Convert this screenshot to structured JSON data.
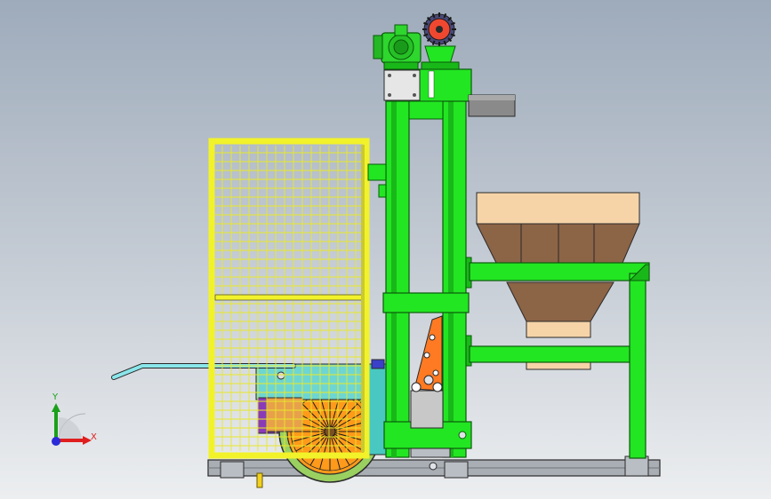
{
  "triad": {
    "y_label": "Y",
    "x_label": "X",
    "colors": {
      "y": "#1aa01a",
      "x": "#e01e1e",
      "z": "#2a2ad8"
    }
  },
  "colors": {
    "frame_green": "#22e622",
    "frame_outline": "#0a5a0a",
    "guard_yellow": "#f2f22a",
    "hopper_tan": "#f6d4a8",
    "hopper_brown": "#8c6446",
    "base_gray": "#a9aeb4",
    "hose_cyan": "#8ae6ea",
    "wheel_green": "#9ad060",
    "wheel_rim_orange": "#ff9a1a",
    "bracket_orange": "#ff7a22",
    "gear_red": "#f04830",
    "background_top": "#9eabbb",
    "background_bottom": "#eceef0"
  }
}
